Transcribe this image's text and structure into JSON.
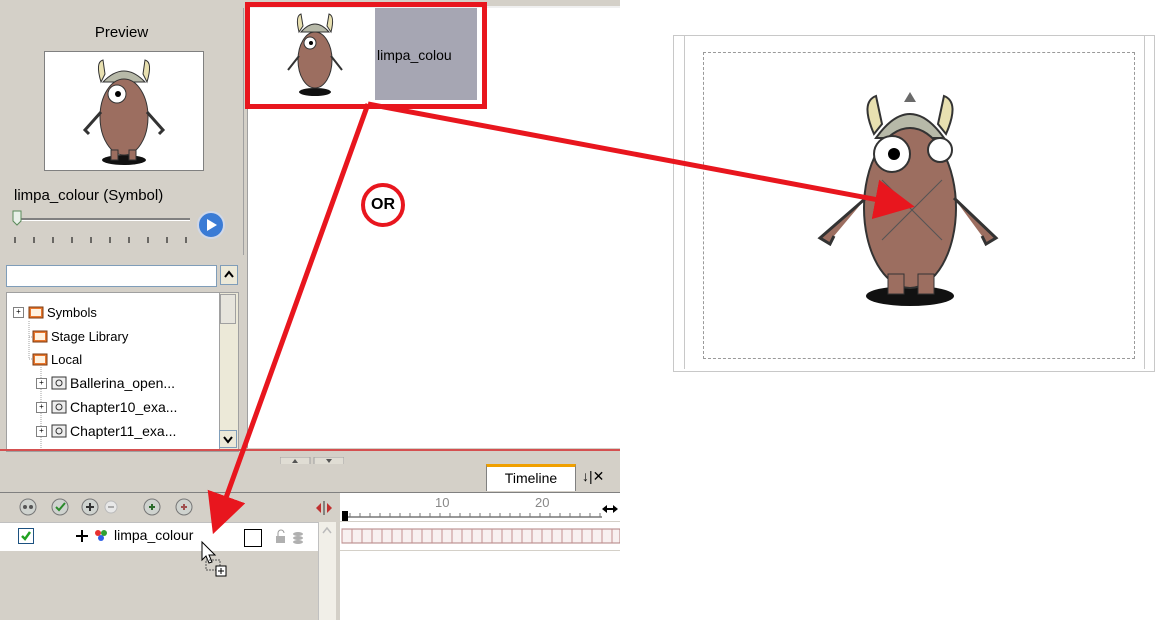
{
  "preview": {
    "title": "Preview",
    "symbol_label": "limpa_colour  (Symbol)"
  },
  "symbol_thumbnail": {
    "label": "limpa_colou"
  },
  "or_label": "OR",
  "tree": {
    "items": [
      {
        "label": "Symbols"
      },
      {
        "label": "Stage Library"
      },
      {
        "label": "Local"
      },
      {
        "label": "Ballerina_open..."
      },
      {
        "label": "Chapter10_exa..."
      },
      {
        "label": "Chapter11_exa..."
      }
    ]
  },
  "timeline": {
    "tab_label": "Timeline",
    "tab_controls": "↓|✕",
    "layer_name": "limpa_colour",
    "ruler_labels": [
      "10",
      "20"
    ]
  },
  "colors": {
    "highlight_red": "#e8161e",
    "panel_bg": "#d4d0c8",
    "folder_orange": "#e8762c",
    "tab_accent": "#f0a000"
  },
  "icons": [
    "play-icon",
    "folder-icon",
    "expand-plus-icon",
    "checkbox-checked-icon",
    "lock-icon",
    "cursor-copy-icon"
  ]
}
